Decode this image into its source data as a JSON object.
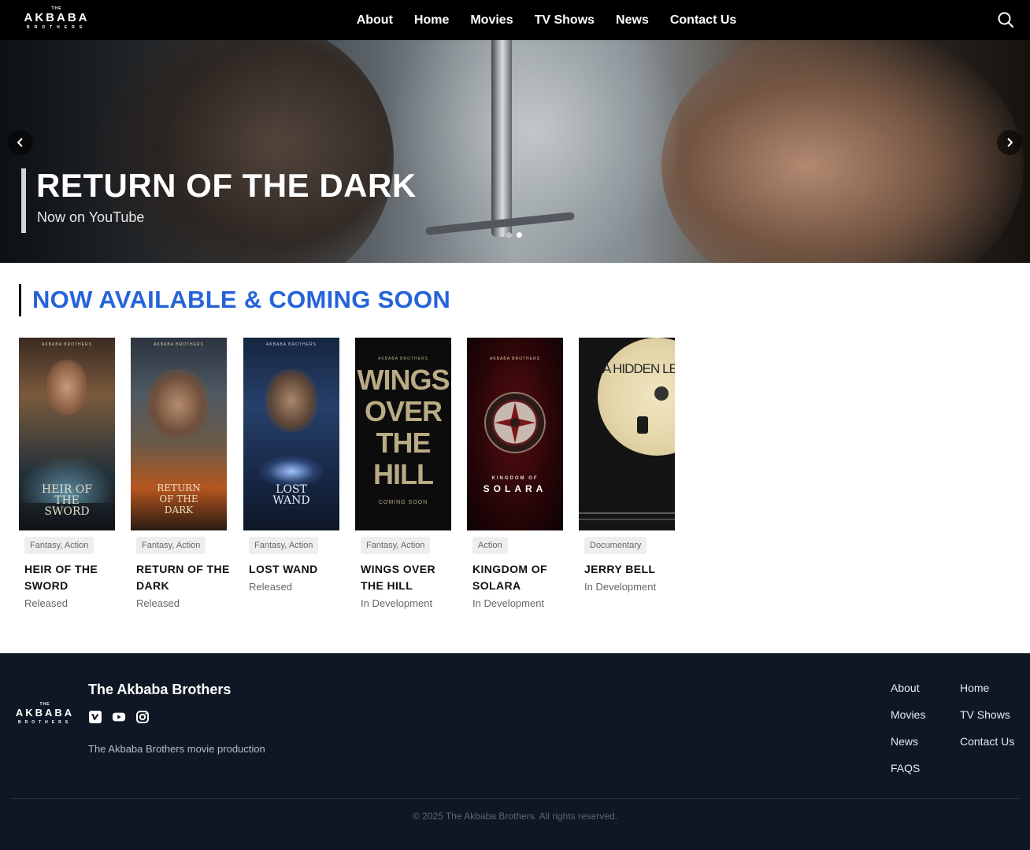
{
  "header": {
    "logo": {
      "top": "THE",
      "main": "AKBABA",
      "bottom": "BROTHERS"
    },
    "nav": [
      "About",
      "Home",
      "Movies",
      "TV Shows",
      "News",
      "Contact Us"
    ],
    "search_icon": "search-icon"
  },
  "hero": {
    "title": "RETURN OF THE DARK",
    "subtitle": "Now on YouTube",
    "slide_count": 2,
    "active_slide": 2
  },
  "section": {
    "title": "NOW AVAILABLE & COMING SOON"
  },
  "movies": [
    {
      "genre": "Fantasy, Action",
      "title": "HEIR OF THE SWORD",
      "status": "Released",
      "poster_top": "AKBABA BROTHERS",
      "poster_title": "HEIR OF THE SWORD",
      "colors": [
        "#3b2a22",
        "#7a5a3c",
        "#24323a"
      ]
    },
    {
      "genre": "Fantasy, Action",
      "title": "RETURN OF THE DARK",
      "status": "Released",
      "poster_top": "AKBABA BROTHERS",
      "poster_title": "RETURN OF THE DARK",
      "colors": [
        "#2b3440",
        "#6b5a48",
        "#b5561f"
      ]
    },
    {
      "genre": "Fantasy, Action",
      "title": "LOST WAND",
      "status": "Released",
      "poster_top": "AKBABA BROTHERS",
      "poster_title": "LOST WAND",
      "colors": [
        "#14253f",
        "#27406b",
        "#0d1626"
      ]
    },
    {
      "genre": "Fantasy, Action",
      "title": "WINGS OVER THE HILL",
      "status": "In Development",
      "poster_top": "AKBABA BROTHERS",
      "poster_title": "WINGS OVER THE HILL",
      "poster_note": "COMING SOON",
      "colors": [
        "#0c0c0c",
        "#1b1b1b",
        "#0a0a0a"
      ]
    },
    {
      "genre": "Action",
      "title": "KINGDOM OF SOLARA",
      "status": "In Development",
      "poster_top": "AKBABA BROTHERS",
      "poster_title": "KINGDOM OF",
      "poster_title2": "SOLARA",
      "colors": [
        "#1a0506",
        "#5a0d12",
        "#0d0203"
      ]
    },
    {
      "genre": "Documentary",
      "title": "JERRY BELL",
      "status": "In Development",
      "poster_title": "A HIDDEN LE",
      "colors": [
        "#111111",
        "#2a2a2a",
        "#e8dcb0"
      ]
    }
  ],
  "footer": {
    "logo": {
      "top": "THE",
      "main": "AKBABA",
      "bottom": "BROTHERS"
    },
    "brand": "The Akbaba Brothers",
    "socials": [
      "vimeo-icon",
      "youtube-icon",
      "instagram-icon"
    ],
    "description": "The Akbaba Brothers movie production",
    "links_col1": [
      "About",
      "Movies",
      "News",
      "FAQS"
    ],
    "links_col2": [
      "Home",
      "TV Shows",
      "Contact Us"
    ],
    "copyright": "© 2025 The Akbaba Brothers. All rights reserved."
  },
  "colors": {
    "accent": "#2563d9",
    "footer_bg": "#0f1724",
    "header_bg": "#000000"
  }
}
